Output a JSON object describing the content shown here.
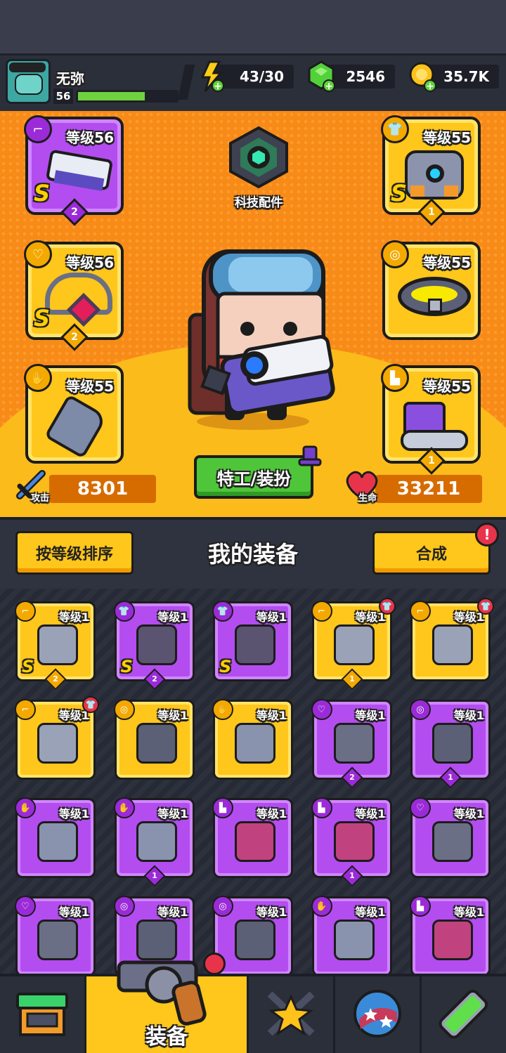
{
  "player": {
    "name": "无弥",
    "level": "56",
    "xp_fraction": 0.68
  },
  "resources": {
    "energy": "43/30",
    "gems": "2546",
    "coins": "35.7K"
  },
  "hero": {
    "tech_parts_label": "科技配件",
    "agent_button": "特工/装扮",
    "attack_label": "攻击",
    "attack_value": "8301",
    "life_label": "生命",
    "life_value": "33211",
    "slots": [
      {
        "name": "weapon",
        "level_text": "等级56",
        "rank": "S",
        "stars": "2",
        "color": "purple",
        "icon": "gun-icon"
      },
      {
        "name": "armor",
        "level_text": "等级55",
        "rank": "S",
        "stars": "1",
        "color": "yellow",
        "icon": "vest-icon"
      },
      {
        "name": "necklace",
        "level_text": "等级56",
        "rank": "S",
        "stars": "2",
        "color": "yellow",
        "icon": "necklace-icon"
      },
      {
        "name": "belt",
        "level_text": "等级55",
        "rank": "",
        "stars": "",
        "color": "yellow",
        "icon": "belt-icon"
      },
      {
        "name": "gloves",
        "level_text": "等级55",
        "rank": "",
        "stars": "",
        "color": "yellow",
        "icon": "glove-icon"
      },
      {
        "name": "boots",
        "level_text": "等级55",
        "rank": "",
        "stars": "1",
        "color": "yellow",
        "icon": "boot-icon"
      }
    ]
  },
  "equipment_bar": {
    "sort_button": "按等级排序",
    "title": "我的装备",
    "merge_button": "合成",
    "merge_alert": "!"
  },
  "inventory": [
    {
      "lv": "等级1",
      "color": "yellow",
      "rank": "S",
      "stars": "2",
      "icon": "gun-icon"
    },
    {
      "lv": "等级1",
      "color": "purple",
      "rank": "S",
      "stars": "2",
      "icon": "vest-icon"
    },
    {
      "lv": "等级1",
      "color": "purple",
      "rank": "S",
      "stars": "",
      "icon": "vest-icon"
    },
    {
      "lv": "等级1",
      "color": "yellow",
      "rank": "",
      "stars": "1",
      "icon": "gun-icon",
      "new": true
    },
    {
      "lv": "等级1",
      "color": "yellow",
      "rank": "",
      "stars": "",
      "icon": "gun-icon",
      "new": true
    },
    {
      "lv": "等级1",
      "color": "yellow",
      "rank": "",
      "stars": "",
      "icon": "gun-icon",
      "new": true
    },
    {
      "lv": "等级1",
      "color": "yellow",
      "rank": "",
      "stars": "",
      "icon": "belt-icon"
    },
    {
      "lv": "等级1",
      "color": "yellow",
      "rank": "",
      "stars": "",
      "icon": "glove-icon"
    },
    {
      "lv": "等级1",
      "color": "purple",
      "rank": "",
      "stars": "2",
      "icon": "necklace-icon"
    },
    {
      "lv": "等级1",
      "color": "purple",
      "rank": "",
      "stars": "1",
      "icon": "belt-icon"
    },
    {
      "lv": "等级1",
      "color": "purple",
      "rank": "",
      "stars": "",
      "icon": "glove-icon"
    },
    {
      "lv": "等级1",
      "color": "purple",
      "rank": "",
      "stars": "1",
      "icon": "glove-icon"
    },
    {
      "lv": "等级1",
      "color": "purple",
      "rank": "",
      "stars": "",
      "icon": "boot-icon"
    },
    {
      "lv": "等级1",
      "color": "purple",
      "rank": "",
      "stars": "1",
      "icon": "boot-icon"
    },
    {
      "lv": "等级1",
      "color": "purple",
      "rank": "",
      "stars": "",
      "icon": "necklace-icon"
    },
    {
      "lv": "等级1",
      "color": "purple",
      "rank": "",
      "stars": "",
      "icon": "necklace-icon"
    },
    {
      "lv": "等级1",
      "color": "purple",
      "rank": "",
      "stars": "",
      "icon": "belt-icon"
    },
    {
      "lv": "等级1",
      "color": "purple",
      "rank": "",
      "stars": "",
      "icon": "belt-icon"
    },
    {
      "lv": "等级1",
      "color": "purple",
      "rank": "",
      "stars": "",
      "icon": "glove-icon"
    },
    {
      "lv": "等级1",
      "color": "purple",
      "rank": "",
      "stars": "",
      "icon": "boot-icon"
    }
  ],
  "nav": {
    "tabs": [
      {
        "name": "shop",
        "label": "",
        "icon": "shop-icon"
      },
      {
        "name": "equipment",
        "label": "装备",
        "icon": "revolver-icon",
        "active": true
      },
      {
        "name": "battle",
        "label": "",
        "icon": "crossed-swords-star-icon"
      },
      {
        "name": "world",
        "label": "",
        "icon": "planet-icon"
      },
      {
        "name": "lab",
        "label": "",
        "icon": "dna-tube-icon"
      }
    ]
  },
  "colors": {
    "hero_bg": "#f88a17",
    "slot_yellow": "#ffc61b",
    "slot_purple": "#b34df0",
    "button_green": "#4fc53a",
    "alert_red": "#e8344a"
  }
}
